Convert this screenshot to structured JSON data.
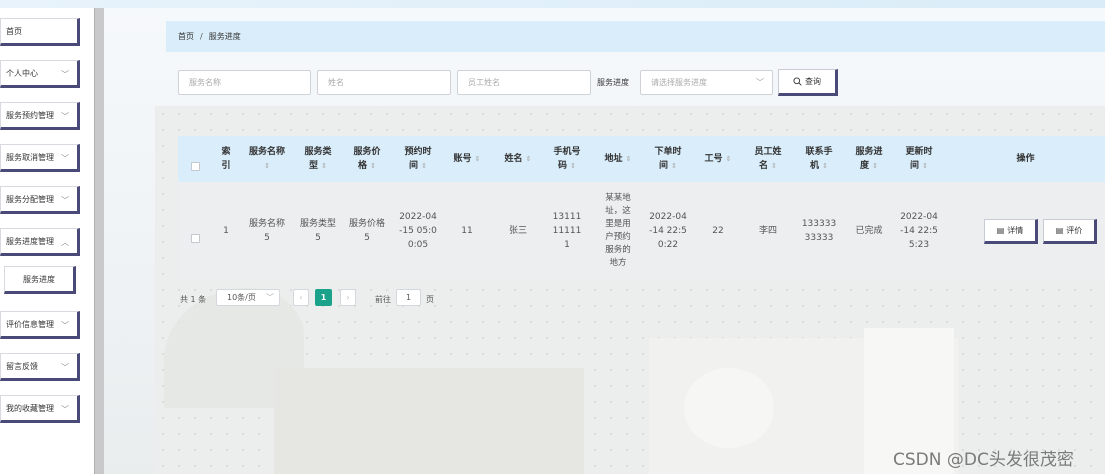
{
  "sidebar": {
    "items": [
      {
        "label": "首页",
        "chevron": false
      },
      {
        "label": "个人中心",
        "chevron": true
      },
      {
        "label": "服务预约管理",
        "chevron": true
      },
      {
        "label": "服务取消管理",
        "chevron": true
      },
      {
        "label": "服务分配管理",
        "chevron": true
      },
      {
        "label": "服务进度管理",
        "chevron": true
      },
      {
        "label": "服务进度",
        "chevron": false,
        "sub": true
      },
      {
        "label": "评价信息管理",
        "chevron": true
      },
      {
        "label": "留言反馈",
        "chevron": true
      },
      {
        "label": "我的收藏管理",
        "chevron": true
      }
    ]
  },
  "breadcrumb": {
    "home": "首页",
    "separator": "/",
    "current": "服务进度"
  },
  "search": {
    "service_name_placeholder": "服务名称",
    "name_placeholder": "姓名",
    "employee_name_placeholder": "员工姓名",
    "progress_label": "服务进度",
    "progress_placeholder": "请选择服务进度",
    "query_label": "查询"
  },
  "table": {
    "headers": {
      "index": "索引",
      "service_name": "服务名称",
      "service_type": "服务类型",
      "service_price": "服务价格",
      "booking_time": "预约时间",
      "account": "账号",
      "name": "姓名",
      "phone": "手机号码",
      "address": "地址",
      "order_time": "下单时间",
      "employee_id": "工号",
      "employee_name": "员工姓名",
      "contact_phone": "联系手机",
      "progress": "服务进度",
      "update_time": "更新时间",
      "actions": "操作"
    },
    "row": {
      "index": "1",
      "service_name": "服务名称5",
      "service_type": "服务类型5",
      "service_price": "服务价格5",
      "booking_time": "2022-04-15 05:00:05",
      "account": "11",
      "name": "张三",
      "phone": "13111111111",
      "address": "某某地址，这里是用户预约服务的地方",
      "order_time": "2022-04-14 22:50:22",
      "employee_id": "22",
      "employee_name": "李四",
      "contact_phone": "13333333333",
      "progress": "已完成",
      "update_time": "2022-04-14 22:55:23",
      "detail_label": "详情",
      "review_label": "评价"
    }
  },
  "pagination": {
    "total": "共 1 条",
    "page_size": "10条/页",
    "current_page": "1",
    "goto_label": "前往",
    "goto_value": "1",
    "page_suffix": "页"
  },
  "watermark": "CSDN @DC头发很茂密"
}
